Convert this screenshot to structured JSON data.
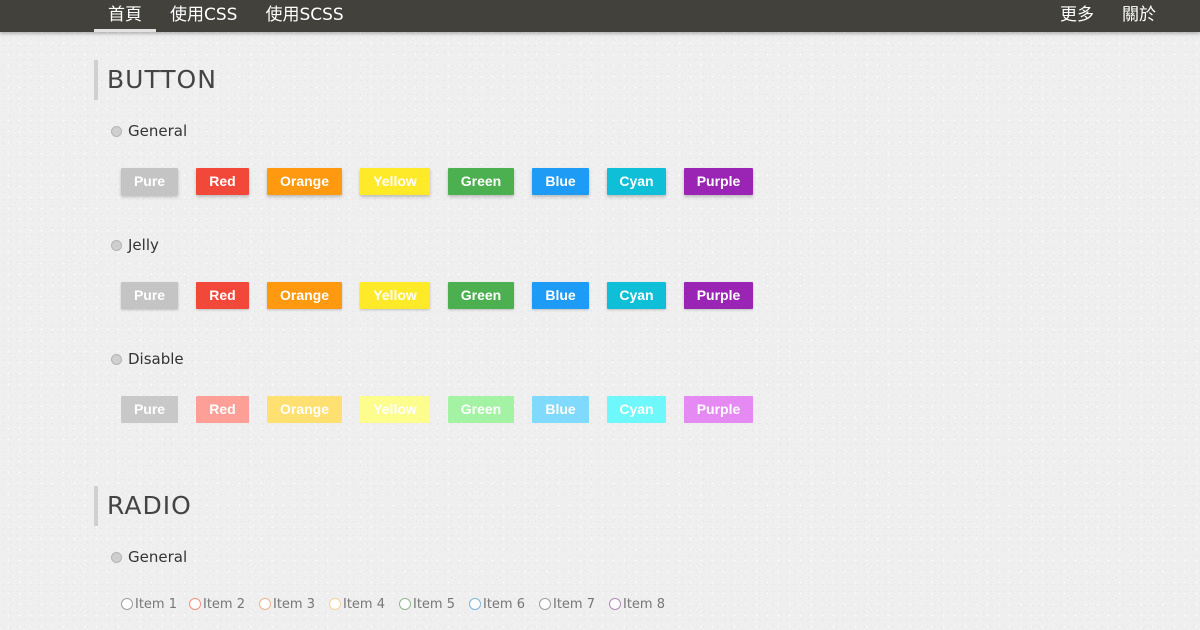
{
  "nav": {
    "left": [
      "首頁",
      "使用CSS",
      "使用SCSS"
    ],
    "right": [
      "更多",
      "關於"
    ]
  },
  "button_section": {
    "title": "BUTTON",
    "groups": [
      {
        "label": "General",
        "buttons": [
          {
            "label": "Pure",
            "color": "#c4c4c4"
          },
          {
            "label": "Red",
            "color": "#f2483a"
          },
          {
            "label": "Orange",
            "color": "#ff9a10"
          },
          {
            "label": "Yellow",
            "color": "#ffea2a"
          },
          {
            "label": "Green",
            "color": "#4caf50"
          },
          {
            "label": "Blue",
            "color": "#1e9bf5"
          },
          {
            "label": "Cyan",
            "color": "#0fbfd8"
          },
          {
            "label": "Purple",
            "color": "#9a24b3"
          }
        ]
      },
      {
        "label": "Jelly",
        "buttons": [
          {
            "label": "Pure",
            "color": "#c4c4c4"
          },
          {
            "label": "Red",
            "color": "#f2483a"
          },
          {
            "label": "Orange",
            "color": "#ff9a10"
          },
          {
            "label": "Yellow",
            "color": "#ffea2a"
          },
          {
            "label": "Green",
            "color": "#4caf50"
          },
          {
            "label": "Blue",
            "color": "#1e9bf5"
          },
          {
            "label": "Cyan",
            "color": "#0fbfd8"
          },
          {
            "label": "Purple",
            "color": "#9a24b3"
          }
        ]
      },
      {
        "label": "Disable",
        "buttons": [
          {
            "label": "Pure",
            "color": "#c8c8c8"
          },
          {
            "label": "Red",
            "color": "#fd9f96"
          },
          {
            "label": "Orange",
            "color": "#ffe070"
          },
          {
            "label": "Yellow",
            "color": "#fdfd8e"
          },
          {
            "label": "Green",
            "color": "#a4f2a4"
          },
          {
            "label": "Blue",
            "color": "#7fdafd"
          },
          {
            "label": "Cyan",
            "color": "#6ef8fb"
          },
          {
            "label": "Purple",
            "color": "#e48af2"
          }
        ]
      }
    ]
  },
  "radio_section": {
    "title": "RADIO",
    "groups": [
      {
        "label": "General",
        "items": [
          {
            "label": "Item 1",
            "color": "#9e9e9e"
          },
          {
            "label": "Item 2",
            "color": "#f0917f"
          },
          {
            "label": "Item 3",
            "color": "#eeb48a"
          },
          {
            "label": "Item 4",
            "color": "#f0d49e"
          },
          {
            "label": "Item 5",
            "color": "#8fb98f"
          },
          {
            "label": "Item 6",
            "color": "#7fb3db"
          },
          {
            "label": "Item 7",
            "color": "#9e9e9e"
          },
          {
            "label": "Item 8",
            "color": "#b08ab8"
          }
        ]
      }
    ]
  }
}
